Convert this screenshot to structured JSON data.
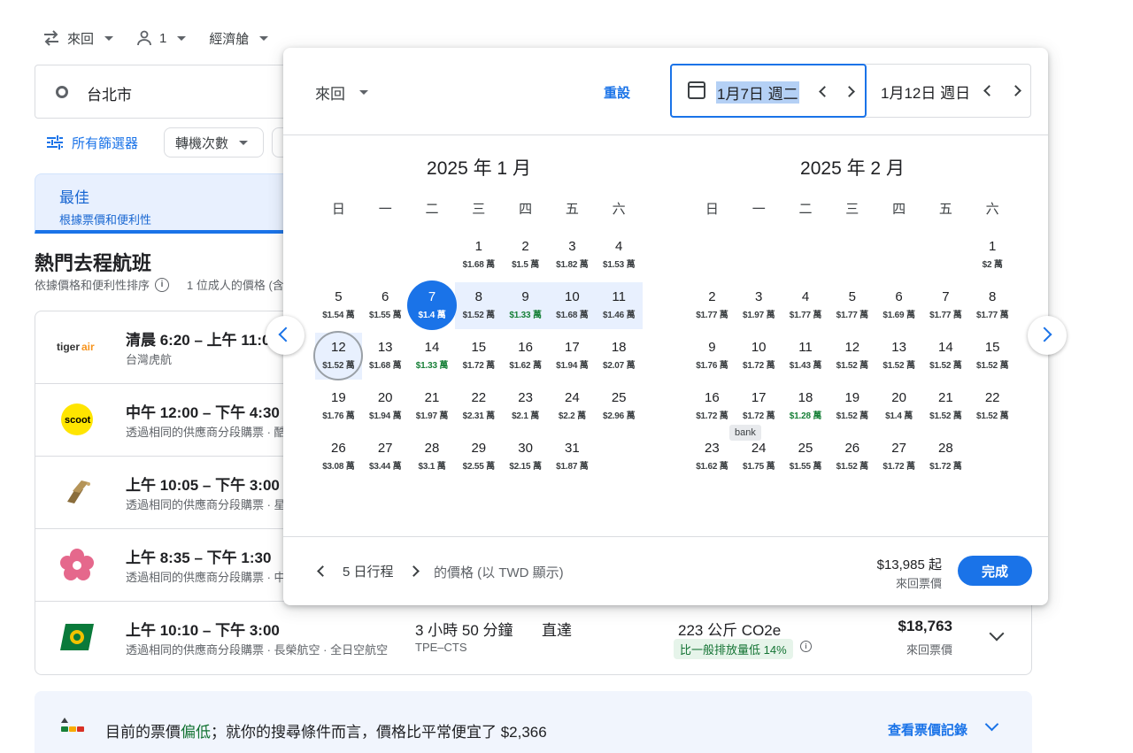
{
  "topbar": {
    "trip_type": "來回",
    "passengers": "1",
    "cabin": "經濟艙"
  },
  "origin": {
    "value": "台北市"
  },
  "filters": {
    "all_filters": "所有篩選器",
    "stops": "轉機次數"
  },
  "best_tab": {
    "title": "最佳",
    "subtitle": "根據票價和便利性"
  },
  "section": {
    "title": "熱門去程航班",
    "sort_note": "依據價格和便利性排序",
    "price_note": "1 位成人的價格 (含"
  },
  "flights": [
    {
      "logo": "tigerair",
      "time": "清晨 6:20 – 上午 11:0",
      "airline": "台灣虎航"
    },
    {
      "logo": "scoot",
      "time": "中午 12:00 – 下午 4:30",
      "airline": "透過相同的供應商分段購票 · 酷"
    },
    {
      "logo": "starlux",
      "time": "上午 10:05 – 下午 3:00",
      "airline": "透過相同的供應商分段購票 · 星"
    },
    {
      "logo": "china-airlines",
      "time": "上午 8:35 – 下午 1:30",
      "airline": "透過相同的供應商分段購票 · 中"
    },
    {
      "logo": "eva-air",
      "time": "上午 10:10 – 下午 3:00",
      "airline": "透過相同的供應商分段購票 · 長榮航空 · 全日空航空",
      "duration": "3 小時 50 分鐘",
      "route": "TPE–CTS",
      "stops": "直達",
      "co2": "223 公斤 CO2e",
      "co2_badge": "比一般排放量低 14%",
      "price": "$18,763",
      "price_type": "來回票價"
    }
  ],
  "insight": {
    "prefix": "目前的票價",
    "level": "偏低",
    "suffix": "；就你的搜尋條件而言，價格比平常便宜了 $2,366",
    "history_link": "查看票價記錄"
  },
  "picker": {
    "trip_type": "來回",
    "reset": "重設",
    "departure": "1月7日 週二",
    "return": "1月12日 週日",
    "weekdays": [
      "日",
      "一",
      "二",
      "三",
      "四",
      "五",
      "六"
    ],
    "months": [
      {
        "title": "2025 年 1 月",
        "offset": 3,
        "days": [
          {
            "n": "1",
            "p": "$1.68 萬"
          },
          {
            "n": "2",
            "p": "$1.5 萬"
          },
          {
            "n": "3",
            "p": "$1.82 萬"
          },
          {
            "n": "4",
            "p": "$1.53 萬"
          },
          {
            "n": "5",
            "p": "$1.54 萬"
          },
          {
            "n": "6",
            "p": "$1.55 萬"
          },
          {
            "n": "7",
            "p": "$1.4 萬",
            "sel": true
          },
          {
            "n": "8",
            "p": "$1.52 萬",
            "range": true
          },
          {
            "n": "9",
            "p": "$1.33 萬",
            "g": true,
            "range": true
          },
          {
            "n": "10",
            "p": "$1.68 萬",
            "range": true
          },
          {
            "n": "11",
            "p": "$1.46 萬",
            "range": true
          },
          {
            "n": "12",
            "p": "$1.52 萬",
            "hov": true,
            "range": true
          },
          {
            "n": "13",
            "p": "$1.68 萬"
          },
          {
            "n": "14",
            "p": "$1.33 萬",
            "g": true
          },
          {
            "n": "15",
            "p": "$1.72 萬"
          },
          {
            "n": "16",
            "p": "$1.62 萬"
          },
          {
            "n": "17",
            "p": "$1.94 萬"
          },
          {
            "n": "18",
            "p": "$2.07 萬"
          },
          {
            "n": "19",
            "p": "$1.76 萬"
          },
          {
            "n": "20",
            "p": "$1.94 萬"
          },
          {
            "n": "21",
            "p": "$1.97 萬"
          },
          {
            "n": "22",
            "p": "$2.31 萬"
          },
          {
            "n": "23",
            "p": "$2.1 萬"
          },
          {
            "n": "24",
            "p": "$2.2 萬"
          },
          {
            "n": "25",
            "p": "$2.96 萬"
          },
          {
            "n": "26",
            "p": "$3.08 萬"
          },
          {
            "n": "27",
            "p": "$3.44 萬"
          },
          {
            "n": "28",
            "p": "$3.1 萬"
          },
          {
            "n": "29",
            "p": "$2.55 萬"
          },
          {
            "n": "30",
            "p": "$2.15 萬"
          },
          {
            "n": "31",
            "p": "$1.87 萬"
          }
        ]
      },
      {
        "title": "2025 年 2 月",
        "offset": 6,
        "days": [
          {
            "n": "1",
            "p": "$2 萬"
          },
          {
            "n": "2",
            "p": "$1.77 萬"
          },
          {
            "n": "3",
            "p": "$1.97 萬"
          },
          {
            "n": "4",
            "p": "$1.77 萬"
          },
          {
            "n": "5",
            "p": "$1.77 萬"
          },
          {
            "n": "6",
            "p": "$1.69 萬"
          },
          {
            "n": "7",
            "p": "$1.77 萬"
          },
          {
            "n": "8",
            "p": "$1.77 萬"
          },
          {
            "n": "9",
            "p": "$1.76 萬"
          },
          {
            "n": "10",
            "p": "$1.72 萬"
          },
          {
            "n": "11",
            "p": "$1.43 萬"
          },
          {
            "n": "12",
            "p": "$1.52 萬"
          },
          {
            "n": "13",
            "p": "$1.52 萬"
          },
          {
            "n": "14",
            "p": "$1.52 萬"
          },
          {
            "n": "15",
            "p": "$1.52 萬"
          },
          {
            "n": "16",
            "p": "$1.72 萬"
          },
          {
            "n": "17",
            "p": "$1.72 萬"
          },
          {
            "n": "18",
            "p": "$1.28 萬",
            "g": true
          },
          {
            "n": "19",
            "p": "$1.52 萬"
          },
          {
            "n": "20",
            "p": "$1.4 萬"
          },
          {
            "n": "21",
            "p": "$1.52 萬"
          },
          {
            "n": "22",
            "p": "$1.52 萬"
          },
          {
            "n": "23",
            "p": "$1.62 萬"
          },
          {
            "n": "24",
            "p": "$1.75 萬"
          },
          {
            "n": "25",
            "p": "$1.55 萬"
          },
          {
            "n": "26",
            "p": "$1.52 萬"
          },
          {
            "n": "27",
            "p": "$1.72 萬"
          },
          {
            "n": "28",
            "p": "$1.72 萬"
          }
        ]
      }
    ],
    "tooltip": "bank",
    "trip_length": "5 日行程",
    "currency_note": "的價格 (以 TWD 顯示)",
    "from_price": "$13,985 起",
    "price_type": "來回票價",
    "done": "完成"
  },
  "colors": {
    "accent": "#1a73e8",
    "green": "#188038",
    "range": "#e8f0fe"
  }
}
